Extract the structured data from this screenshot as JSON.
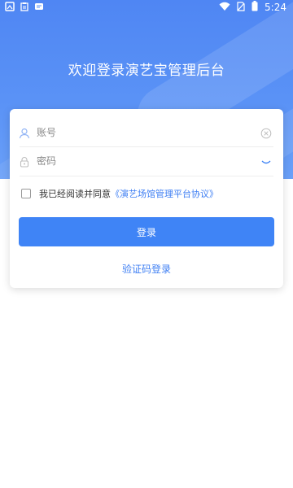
{
  "status_bar": {
    "time": "5:24",
    "icons": [
      "image-icon",
      "clipboard-icon",
      "message-icon",
      "wifi-icon",
      "no-sim-icon",
      "battery-icon"
    ]
  },
  "header": {
    "title": "欢迎登录演艺宝管理后台"
  },
  "form": {
    "account": {
      "placeholder": "账号",
      "value": ""
    },
    "password": {
      "placeholder": "密码",
      "value": ""
    },
    "agreement_text": "我已经阅读并同意",
    "agreement_link": "《演艺场馆管理平台协议》",
    "login_label": "登录",
    "sms_login_label": "验证码登录"
  },
  "colors": {
    "primary": "#3f84f6",
    "link": "#3f7ff3",
    "header_bg": "#5b93f6"
  }
}
